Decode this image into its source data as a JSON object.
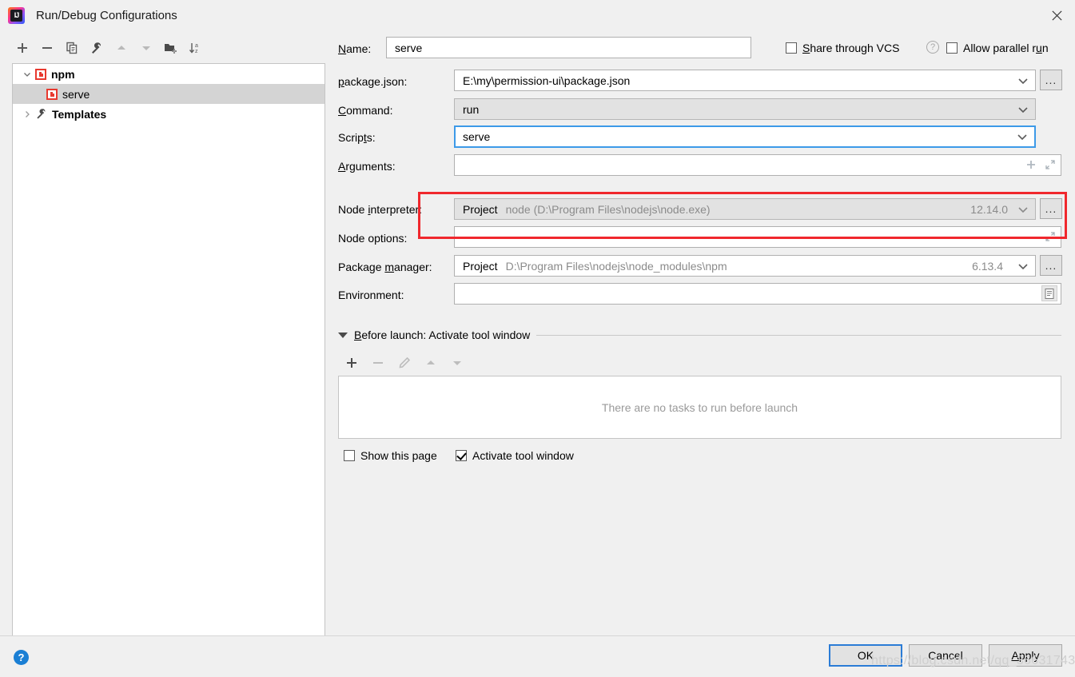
{
  "window": {
    "title": "Run/Debug Configurations",
    "app_icon": "intellij-idea-logo",
    "logo_text": "IJ",
    "close_icon": "close-icon"
  },
  "left_panel": {
    "toolbar": [
      {
        "name": "add-configuration-button",
        "icon": "plus-icon",
        "enabled": true
      },
      {
        "name": "remove-configuration-button",
        "icon": "minus-icon",
        "enabled": true
      },
      {
        "name": "copy-configuration-button",
        "icon": "copy-icon",
        "enabled": true
      },
      {
        "name": "edit-templates-button",
        "icon": "wrench-icon",
        "enabled": true
      },
      {
        "name": "move-up-button",
        "icon": "arrow-up-icon",
        "enabled": false
      },
      {
        "name": "move-down-button",
        "icon": "arrow-down-icon",
        "enabled": false
      },
      {
        "name": "new-folder-button",
        "icon": "folder-add-icon",
        "enabled": true
      },
      {
        "name": "sort-configurations-button",
        "icon": "sort-alpha-icon",
        "enabled": true
      }
    ],
    "tree": [
      {
        "label": "npm",
        "icon": "npm-icon",
        "expanded": true,
        "depth": 0,
        "selected": false,
        "bold": true,
        "twisty": "chevron-down-icon"
      },
      {
        "label": "serve",
        "icon": "npm-icon",
        "expanded": false,
        "depth": 1,
        "selected": true,
        "bold": false,
        "twisty": ""
      },
      {
        "label": "Templates",
        "icon": "wrench-icon",
        "expanded": false,
        "depth": 0,
        "selected": false,
        "bold": true,
        "twisty": "chevron-right-icon"
      }
    ]
  },
  "form": {
    "name": {
      "label": "Name:",
      "mnemonic": "N",
      "value": "serve"
    },
    "share_vcs": {
      "label": "Share through VCS",
      "mnemonic": "S",
      "checked": false,
      "help_icon": "question-mark-icon"
    },
    "allow_parallel": {
      "label": "Allow parallel run",
      "mnemonic": "u",
      "checked": false
    },
    "package_json": {
      "label": "package.json:",
      "mnemonic": "p",
      "value": "E:\\my\\permission-ui\\package.json",
      "has_browse": true,
      "browse_label": "...",
      "chevron": "chevron-down-icon"
    },
    "command": {
      "label": "Command:",
      "mnemonic": "C",
      "value": "run",
      "readonly": true,
      "chevron": "chevron-down-icon"
    },
    "scripts": {
      "label": "Scripts:",
      "mnemonic": "t",
      "value": "serve",
      "focused": true,
      "chevron": "chevron-down-icon"
    },
    "arguments": {
      "label": "Arguments:",
      "mnemonic": "A",
      "value": "",
      "icons": [
        "plus-icon",
        "expand-icon"
      ]
    },
    "node_interpreter": {
      "label": "Node interpreter:",
      "mnemonic": "i",
      "prefix": "Project",
      "value": "node (D:\\Program Files\\nodejs\\node.exe)",
      "version": "12.14.0",
      "readonly": true,
      "has_browse": true,
      "browse_label": "...",
      "chevron": "chevron-down-icon"
    },
    "node_options": {
      "label": "Node options:",
      "mnemonic": "",
      "value": "",
      "icons": [
        "expand-icon"
      ]
    },
    "package_manager": {
      "label": "Package manager:",
      "mnemonic": "m",
      "prefix": "Project",
      "value": "D:\\Program Files\\nodejs\\node_modules\\npm",
      "version": "6.13.4",
      "has_browse": true,
      "browse_label": "...",
      "chevron": "chevron-down-icon"
    },
    "environment": {
      "label": "Environment:",
      "mnemonic": "",
      "value": "",
      "icons": [
        "list-editor-icon"
      ]
    }
  },
  "before_launch": {
    "title": "Before launch: Activate tool window",
    "mnemonic": "B",
    "expanded": true,
    "toolbar": [
      {
        "name": "add-task-button",
        "icon": "plus-icon",
        "enabled": true
      },
      {
        "name": "remove-task-button",
        "icon": "minus-icon",
        "enabled": false
      },
      {
        "name": "edit-task-button",
        "icon": "pencil-icon",
        "enabled": false
      },
      {
        "name": "task-move-up-button",
        "icon": "arrow-up-icon",
        "enabled": false
      },
      {
        "name": "task-move-down-button",
        "icon": "arrow-down-icon",
        "enabled": false
      }
    ],
    "empty_text": "There are no tasks to run before launch",
    "show_this_page": {
      "label": "Show this page",
      "checked": false
    },
    "activate_tool_window": {
      "label": "Activate tool window",
      "checked": true
    }
  },
  "footer": {
    "help_label": "?",
    "ok_label": "OK",
    "cancel_label": "Cancel",
    "apply_label": "Apply",
    "apply_mnemonic": "A",
    "watermark": "https://blog.csdn.net/qq_36631743"
  },
  "annotation": {
    "type": "red-rectangle-highlight",
    "color": "#f0282d",
    "targets": "node-interpreter-row, node-options-row"
  }
}
